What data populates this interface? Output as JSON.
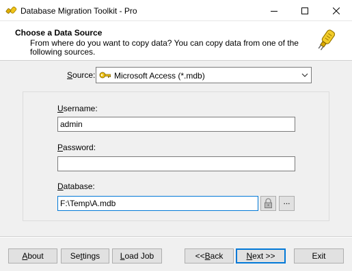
{
  "window": {
    "title": "Database Migration Toolkit - Pro",
    "minimize_icon": "minimize-icon",
    "maximize_icon": "maximize-icon",
    "close_icon": "close-icon"
  },
  "header": {
    "title": "Choose a Data Source",
    "description": "From where do you want to copy data? You can copy data from one of the following sources.",
    "icon": "plug-icon"
  },
  "source": {
    "label_underlined": "S",
    "label_rest": "ource:",
    "selected": "Microsoft Access (*.mdb)",
    "icon": "key-icon"
  },
  "fields": {
    "username": {
      "label_u": "U",
      "label_rest": "sername:",
      "value": "admin"
    },
    "password": {
      "label_u": "P",
      "label_rest": "assword:",
      "value": ""
    },
    "database": {
      "label_u": "D",
      "label_rest": "atabase:",
      "value": "F:\\Temp\\A.mdb"
    }
  },
  "database_buttons": {
    "lock_icon": "lock-icon",
    "browse_label": "..."
  },
  "buttons": {
    "about": {
      "u": "A",
      "rest": "bout"
    },
    "settings": {
      "pre": "Se",
      "u": "t",
      "rest": "tings"
    },
    "load_job": {
      "u": "L",
      "rest": "oad Job"
    },
    "back": {
      "pre": "<< ",
      "u": "B",
      "rest": "ack"
    },
    "next": {
      "u": "N",
      "rest": "ext >>"
    },
    "exit": "Exit"
  },
  "colors": {
    "focus_border": "#0078d7",
    "button_face": "#e1e1e1",
    "window_bg": "#f0f0f0"
  }
}
